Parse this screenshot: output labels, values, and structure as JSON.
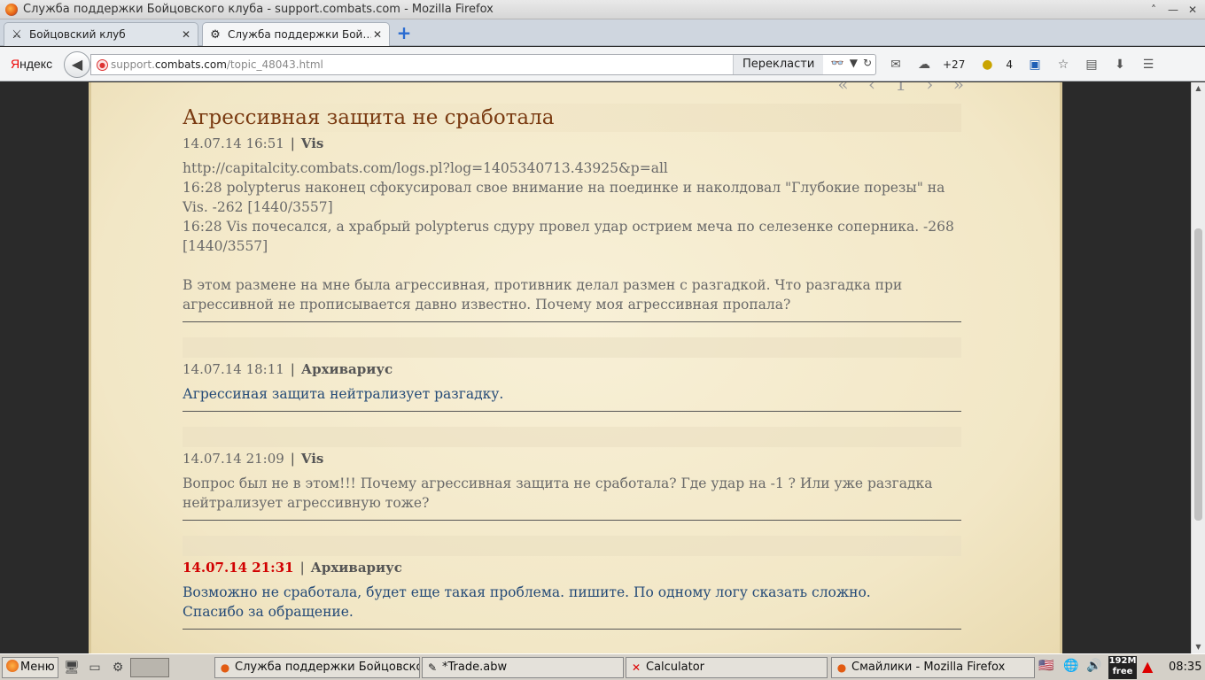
{
  "window": {
    "title": "Служба поддержки Бойцовского клуба - support.combats.com - Mozilla Firefox",
    "controls": [
      "˄",
      "—",
      "✕"
    ]
  },
  "tabs": [
    {
      "label": "Бойцовский клуб",
      "icon": "crossed-swords-icon",
      "close": "✕"
    },
    {
      "label": "Служба поддержки Бой…",
      "icon": "gear-icon",
      "close": "✕"
    }
  ],
  "newtab": "+",
  "nav": {
    "yandex_prefix": "Я",
    "yandex_rest": "ндекс",
    "url_prefix": "support.",
    "url_host": "combats.com",
    "url_path": "/topic_48043.html",
    "translate": "Перекласти",
    "weather": "+27",
    "count": "4"
  },
  "page": {
    "pager": "« ‹ 1 › »",
    "title": "Агрессивная защита не сработала",
    "posts": [
      {
        "date": "14.07.14 16:51",
        "sep": "|",
        "author": "Vis",
        "lines": [
          "http://capitalcity.combats.com/logs.pl?log=1405340713.43925&p=all",
          "16:28 polypterus наконец сфокусировал свое внимание на поединке и наколдовал \"Глубокие порезы\" на Vis. -262 [1440/3557]",
          "16:28 Vis почесался, а храбрый polypterus сдуру провел удар острием меча по селезенке соперника. -268 [1440/3557]",
          "",
          "В этом размене на мне была агрессивная, противник делал размен с разгадкой. Что разгадка при агрессивной не прописывается давно известно. Почему моя агрессивная пропала?"
        ]
      },
      {
        "date": "14.07.14 18:11",
        "sep": "|",
        "author": "Архивариус",
        "lines": [
          "Агрессиная защита нейтрализует разгадку."
        ]
      },
      {
        "date": "14.07.14 21:09",
        "sep": "|",
        "author": "Vis",
        "lines": [
          "Вопрос был не в этом!!! Почему агрессивная защита не сработала? Где удар на -1 ? Или уже разгадка нейтрализует агрессивную тоже?"
        ]
      },
      {
        "date": "14.07.14 21:31",
        "sep": "|",
        "author": "Архивариус",
        "lines": [
          "Возможно не сработала, будет еще такая проблема. пишите. По одному логу сказать сложно.",
          "Спасибо за обращение."
        ]
      }
    ]
  },
  "taskbar": {
    "menu": "Меню",
    "tasks": [
      {
        "label": "Служба поддержки Бойцовского клуба",
        "icon": "firefox-icon"
      },
      {
        "label": "*Trade.abw",
        "icon": "abiword-icon"
      },
      {
        "label": "Calculator",
        "icon": "calculator-icon"
      },
      {
        "label": "Смайлики - Mozilla Firefox",
        "icon": "firefox-icon"
      }
    ],
    "mem_top": "192M",
    "mem_bottom": "free",
    "clock": "08:35"
  },
  "colors": {
    "title": "#7a3b12",
    "admin_text": "#244a77",
    "highlight_date": "#d10000",
    "page_bg": "#f5ecd0"
  }
}
